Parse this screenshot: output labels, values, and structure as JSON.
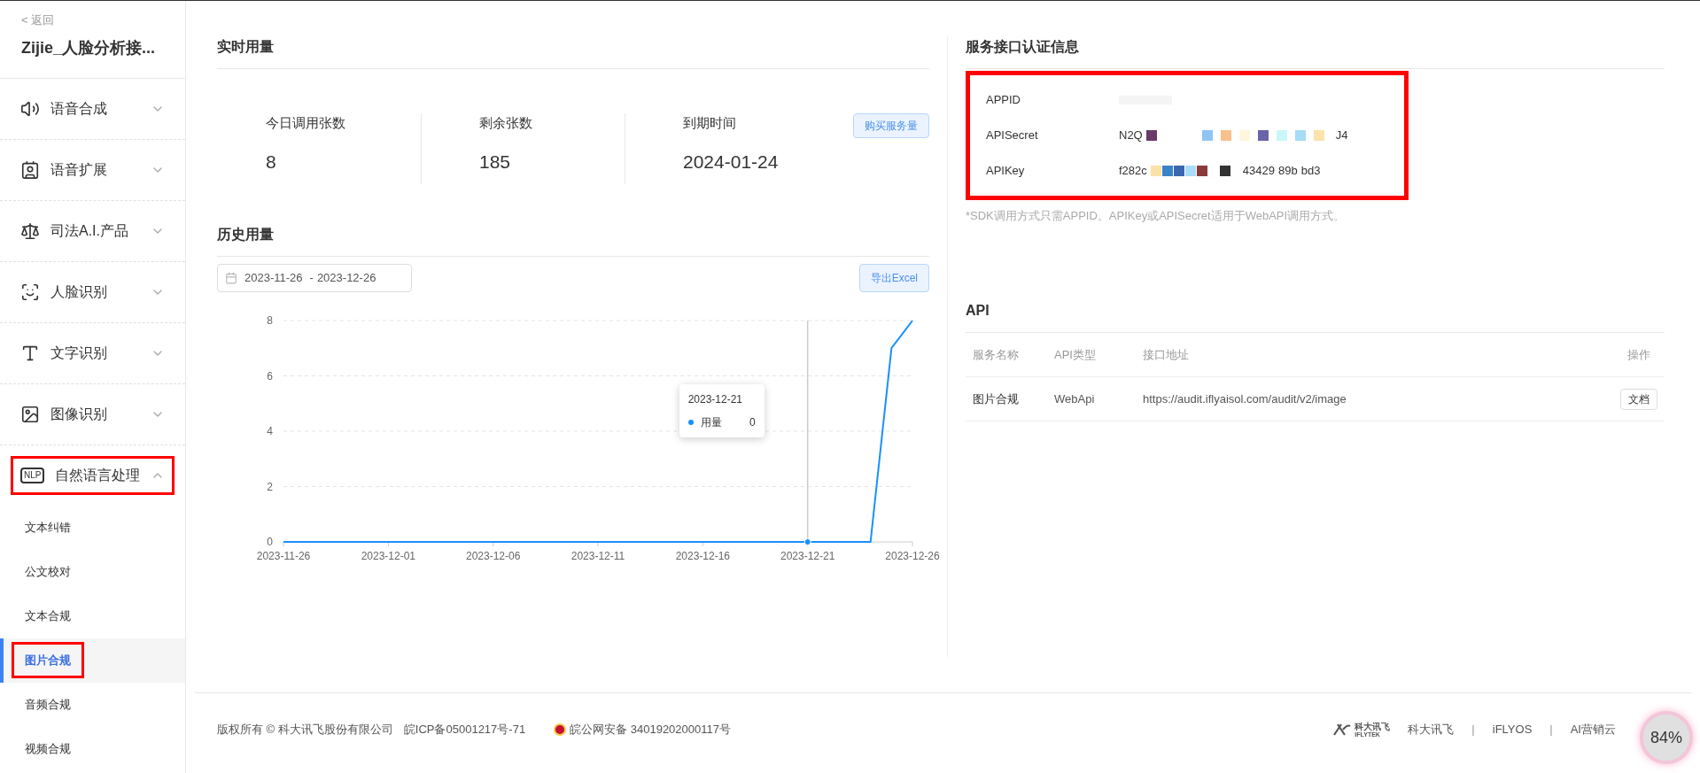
{
  "sidebar": {
    "back": "< 返回",
    "title": "Zijie_人脸分析接...",
    "groups": [
      {
        "label": "语音合成",
        "expanded": false,
        "highlighted": false
      },
      {
        "label": "语音扩展",
        "expanded": false,
        "highlighted": false
      },
      {
        "label": "司法A.I.产品",
        "expanded": false,
        "highlighted": false
      },
      {
        "label": "人脸识别",
        "expanded": false,
        "highlighted": false
      },
      {
        "label": "文字识别",
        "expanded": false,
        "highlighted": false
      },
      {
        "label": "图像识别",
        "expanded": false,
        "highlighted": false
      },
      {
        "label": "自然语言处理",
        "icon_text": "NLP",
        "expanded": true,
        "highlighted": true,
        "children": [
          {
            "label": "文本纠错",
            "selected": false,
            "highlighted": false
          },
          {
            "label": "公文校对",
            "selected": false,
            "highlighted": false
          },
          {
            "label": "文本合规",
            "selected": false,
            "highlighted": false
          },
          {
            "label": "图片合规",
            "selected": true,
            "highlighted": true
          },
          {
            "label": "音频合规",
            "selected": false,
            "highlighted": false
          },
          {
            "label": "视频合规",
            "selected": false,
            "highlighted": false
          }
        ]
      }
    ]
  },
  "realtime": {
    "title": "实时用量",
    "stats": [
      {
        "label": "今日调用张数",
        "value": "8"
      },
      {
        "label": "剩余张数",
        "value": "185"
      },
      {
        "label": "到期时间",
        "value": "2024-01-24"
      }
    ],
    "buy_button": "购买服务量"
  },
  "history": {
    "title": "历史用量",
    "date_range": {
      "start": "2023-11-26",
      "separator": "-",
      "end": "2023-12-26"
    },
    "export_button": "导出Excel",
    "chart_data": {
      "type": "line",
      "x": [
        "2023-11-26",
        "2023-11-27",
        "2023-11-28",
        "2023-11-29",
        "2023-11-30",
        "2023-12-01",
        "2023-12-02",
        "2023-12-03",
        "2023-12-04",
        "2023-12-05",
        "2023-12-06",
        "2023-12-07",
        "2023-12-08",
        "2023-12-09",
        "2023-12-10",
        "2023-12-11",
        "2023-12-12",
        "2023-12-13",
        "2023-12-14",
        "2023-12-15",
        "2023-12-16",
        "2023-12-17",
        "2023-12-18",
        "2023-12-19",
        "2023-12-20",
        "2023-12-21",
        "2023-12-22",
        "2023-12-23",
        "2023-12-24",
        "2023-12-25",
        "2023-12-26"
      ],
      "series": [
        {
          "name": "用量",
          "color": "#1890ff",
          "values": [
            0,
            0,
            0,
            0,
            0,
            0,
            0,
            0,
            0,
            0,
            0,
            0,
            0,
            0,
            0,
            0,
            0,
            0,
            0,
            0,
            0,
            0,
            0,
            0,
            0,
            0,
            0,
            0,
            0,
            7,
            8
          ]
        }
      ],
      "xlim": [
        "2023-11-26",
        "2023-12-26"
      ],
      "ylim": [
        0,
        8
      ],
      "yticks": [
        0,
        2,
        4,
        6,
        8
      ],
      "grid": true,
      "ref_lines": [
        {
          "axis": "x",
          "value": "2023-12-21",
          "color": "#cccccc"
        }
      ],
      "xticks": [
        "2023-11-26",
        "2023-12-01",
        "2023-12-06",
        "2023-12-11",
        "2023-12-16",
        "2023-12-21",
        "2023-12-26"
      ]
    },
    "tooltip": {
      "date": "2023-12-21",
      "value": "0"
    }
  },
  "credentials": {
    "title": "服务接口认证信息",
    "highlighted": true,
    "rows": [
      {
        "label": "APPID",
        "parts": []
      },
      {
        "label": "APISecret",
        "parts": [
          "N2Q",
          "J4"
        ]
      },
      {
        "label": "APIKey",
        "parts": [
          "f282c",
          "43429",
          "89b",
          "bd3"
        ]
      }
    ],
    "note": "*SDK调用方式只需APPID。APIKey或APISecret适用于WebAPI调用方式。"
  },
  "api": {
    "title": "API",
    "columns": [
      "服务名称",
      "API类型",
      "接口地址",
      "操作"
    ],
    "rows": [
      {
        "name": "图片合规",
        "type": "WebApi",
        "url": "https://audit.iflyaisol.com/audit/v2/image",
        "action": "文档"
      }
    ]
  },
  "footer": {
    "copyright": "版权所有 © 科大讯飞股份有限公司",
    "icp": "皖ICP备05001217号-71",
    "police": "皖公网安备 34019202000117号",
    "logo": {
      "cn": "科大讯飞",
      "en": "IFLYTEK"
    },
    "links": [
      "科大讯飞",
      "iFLYOS",
      "AI营销云"
    ],
    "separator": "|"
  },
  "badge": {
    "text": "84%"
  }
}
